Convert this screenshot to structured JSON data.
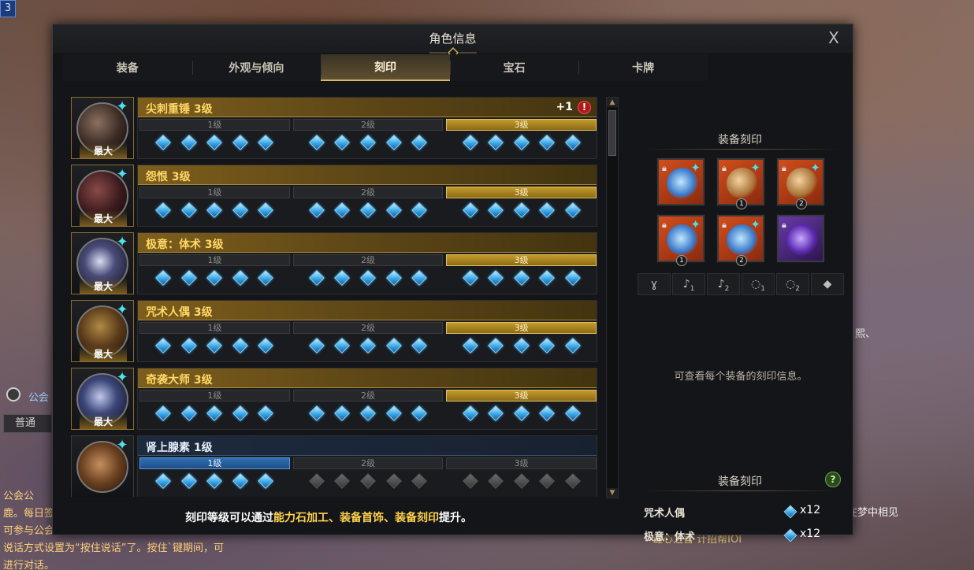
{
  "background": {
    "channel_badge": "3",
    "guild_label": "公会",
    "chat_tab": "普通",
    "chat_lines": [
      "公会公",
      "鹿。每日签到·研究",
      "可参与公会活动",
      "说话方式设置为“按住说话”了。按住`键期间，可",
      "进行对话。"
    ],
    "right_fragment_1": "熙、",
    "right_fragment_2": "在梦中相见",
    "bottom_fragment": "谜心之官 计招帮IOI"
  },
  "window": {
    "title": "角色信息",
    "close_label": "X",
    "tabs": [
      {
        "label": "装备",
        "active": false
      },
      {
        "label": "外观与倾向",
        "active": false
      },
      {
        "label": "刻印",
        "active": true
      },
      {
        "label": "宝石",
        "active": false
      },
      {
        "label": "卡牌",
        "active": false
      }
    ]
  },
  "engravings": [
    {
      "name": "尖刺重锤 3级",
      "max_label": "最大",
      "plus": "+1",
      "alert": "!",
      "tiers": [
        "1级",
        "2级",
        "3级"
      ],
      "active_tier": 3
    },
    {
      "name": "怨恨 3级",
      "max_label": "最大",
      "tiers": [
        "1级",
        "2级",
        "3级"
      ],
      "active_tier": 3
    },
    {
      "name": "极意：体术 3级",
      "max_label": "最大",
      "tiers": [
        "1级",
        "2级",
        "3级"
      ],
      "active_tier": 3
    },
    {
      "name": "咒术人偶 3级",
      "max_label": "最大",
      "tiers": [
        "1级",
        "2级",
        "3级"
      ],
      "active_tier": 3
    },
    {
      "name": "奇袭大师 3级",
      "max_label": "最大",
      "tiers": [
        "1级",
        "2级",
        "3级"
      ],
      "active_tier": 3
    },
    {
      "name": "肾上腺素 1级",
      "max_label": "",
      "tiers": [
        "1级",
        "2级",
        "3级"
      ],
      "active_tier": 1
    }
  ],
  "hint": {
    "prefix": "刻印等级可以通过",
    "highlight": "能力石加工、装备首饰、装备刻印",
    "suffix": "提升。"
  },
  "side": {
    "equip_title": "装备刻印",
    "accessories": [
      {
        "icon": "necklace-icon",
        "num": ""
      },
      {
        "icon": "earring-icon",
        "num": "1"
      },
      {
        "icon": "earring-icon",
        "num": "2"
      },
      {
        "icon": "ring-icon",
        "num": "1"
      },
      {
        "icon": "ring-icon",
        "num": "2"
      },
      {
        "icon": "ability-stone-icon",
        "num": ""
      }
    ],
    "slot_tabs": [
      {
        "symbol": "ɣ",
        "sub": ""
      },
      {
        "symbol": "♪",
        "sub": "1"
      },
      {
        "symbol": "♪",
        "sub": "2"
      },
      {
        "symbol": "◌",
        "sub": "1"
      },
      {
        "symbol": "◌",
        "sub": "2"
      },
      {
        "symbol": "◆",
        "sub": ""
      }
    ],
    "info_text": "可查看每个装备的刻印信息。",
    "summary_title": "装备刻印",
    "help_label": "?",
    "summary": [
      {
        "name": "咒术人偶",
        "count": "x12"
      },
      {
        "name": "极意：体术",
        "count": "x12"
      }
    ]
  }
}
